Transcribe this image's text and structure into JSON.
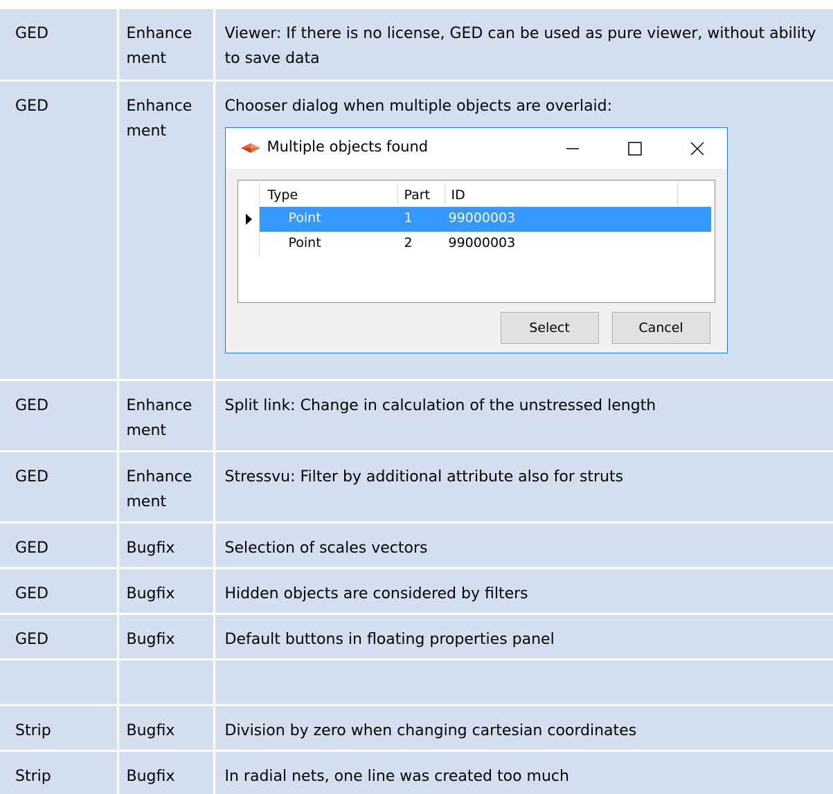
{
  "rows": [
    {
      "module": "GED",
      "type": "Enhance ment",
      "description": "Viewer: If there is no license, GED can be used as pure viewer, without ability to save data"
    },
    {
      "module": "GED",
      "type": "Enhance ment",
      "description": "Chooser dialog when multiple objects are overlaid:"
    },
    {
      "module": "GED",
      "type": "Enhance ment",
      "description": "Split link: Change in calculation of the unstressed length"
    },
    {
      "module": "GED",
      "type": "Enhance ment",
      "description": "Stressvu: Filter by additional attribute also for struts"
    },
    {
      "module": "GED",
      "type": "Bugfix",
      "description": "Selection of scales vectors"
    },
    {
      "module": "GED",
      "type": "Bugfix",
      "description": "Hidden objects are considered by filters"
    },
    {
      "module": "GED",
      "type": "Bugfix",
      "description": "Default buttons in floating properties panel"
    },
    {
      "module": "",
      "type": "",
      "description": ""
    },
    {
      "module": "Strip",
      "type": "Bugfix",
      "description": "Division by zero when changing cartesian coordinates"
    },
    {
      "module": "Strip",
      "type": "Bugfix",
      "description": "In radial nets, one line was created too much"
    }
  ],
  "dialog": {
    "title": "Multiple objects found",
    "columns": [
      "Type",
      "Part",
      "ID"
    ],
    "rows": [
      {
        "type": "Point",
        "part": "1",
        "id": "99000003",
        "selected": true
      },
      {
        "type": "Point",
        "part": "2",
        "id": "99000003",
        "selected": false
      }
    ],
    "select_label": "Select",
    "cancel_label": "Cancel",
    "app_icon": "orange-app-icon",
    "selection_color": "#3399ff",
    "border_color": "#1b7fd4"
  },
  "colors": {
    "cell_background": "#d3dfee"
  }
}
